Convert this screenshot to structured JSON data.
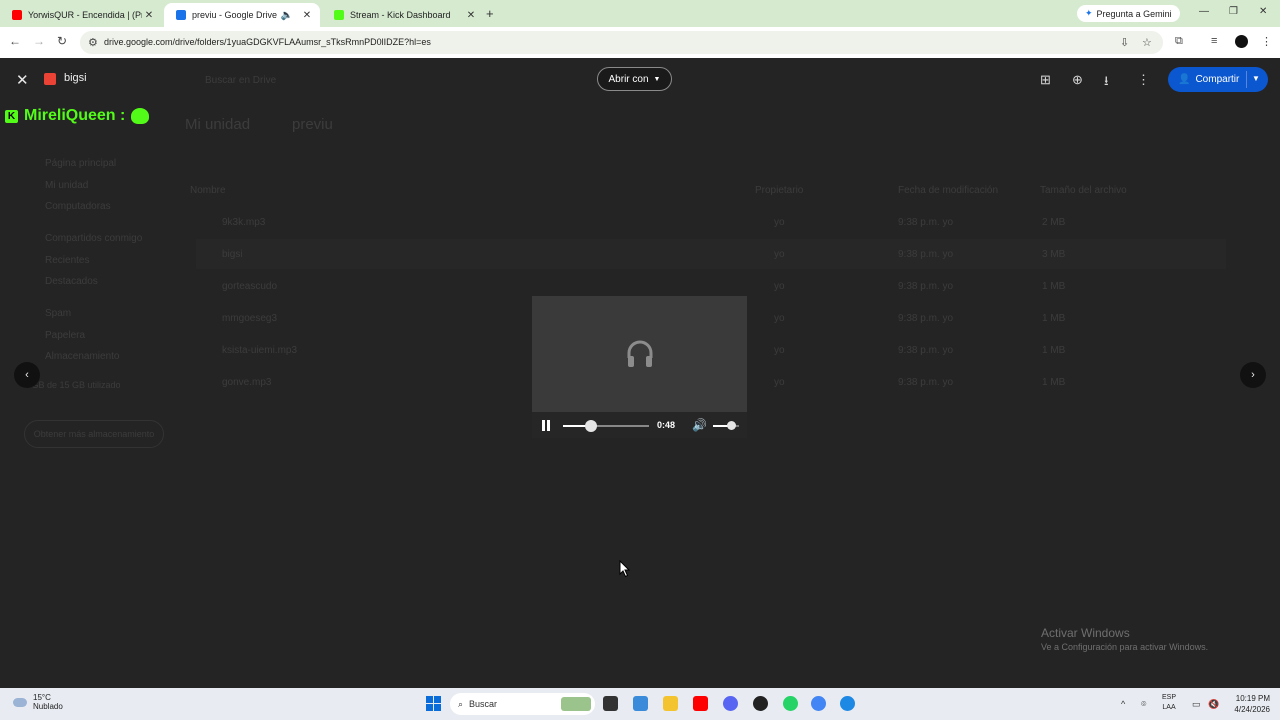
{
  "browser": {
    "tabs": [
      {
        "title": "YorwisQUR - Encendida | (Prod...",
        "favicon_color": "#ff0000",
        "active": false
      },
      {
        "title": "previu - Google Drive",
        "favicon_color": "#1a73e8",
        "active": true,
        "audio_icon": "speaker-icon"
      },
      {
        "title": "Stream - Kick Dashboard",
        "favicon_color": "#53fc18",
        "active": false
      }
    ],
    "new_tab_icon": "+",
    "gemini_label": "Pregunta a Gemini",
    "url": "drive.google.com/drive/folders/1yuaGDGKVFLAAumsr_sTksRmnPD0lIDZE?hl=es"
  },
  "drive_background": {
    "search_placeholder": "Buscar en Drive",
    "breadcrumb": [
      "Mi unidad",
      "previu"
    ],
    "sidebar": [
      "Página principal",
      "Mi unidad",
      "Computadoras",
      "Compartidos conmigo",
      "Recientes",
      "Destacados",
      "Spam",
      "Papelera",
      "Almacenamiento"
    ],
    "storage_text": "1 GB de 15 GB utilizado",
    "storage_button": "Obtener más almacenamiento",
    "columns": [
      "Nombre",
      "Propietario",
      "Fecha de modificación",
      "Tamaño del archivo"
    ],
    "files": [
      {
        "name": "9k3k.mp3",
        "owner": "yo",
        "modified": "9:38 p.m. yo",
        "size": "2 MB"
      },
      {
        "name": "bigsi",
        "owner": "yo",
        "modified": "9:38 p.m. yo",
        "size": "3 MB"
      },
      {
        "name": "gorteascudo",
        "owner": "yo",
        "modified": "9:38 p.m. yo",
        "size": "1 MB"
      },
      {
        "name": "mmgoeseg3",
        "owner": "yo",
        "modified": "9:38 p.m. yo",
        "size": "1 MB"
      },
      {
        "name": "ksista-uiemi.mp3",
        "owner": "yo",
        "modified": "9:38 p.m. yo",
        "size": "1 MB"
      },
      {
        "name": "gonve.mp3",
        "owner": "yo",
        "modified": "9:38 p.m. yo",
        "size": "1 MB"
      }
    ]
  },
  "viewer": {
    "filename": "bigsi",
    "open_with_label": "Abrir con",
    "share_label": "Compartir",
    "overlay_brand": "MireliQueen :",
    "player": {
      "time": "0:48",
      "progress_fraction": 0.33,
      "volume_fraction": 0.7
    }
  },
  "watermark": {
    "title": "Activar Windows",
    "subtitle": "Ve a Configuración para activar Windows."
  },
  "taskbar": {
    "weather_temp": "15°C",
    "weather_desc": "Nublado",
    "search_placeholder": "Buscar",
    "lang_top": "ESP",
    "lang_bottom": "LAA",
    "time": "10:19 PM",
    "date": "4/24/2026"
  }
}
